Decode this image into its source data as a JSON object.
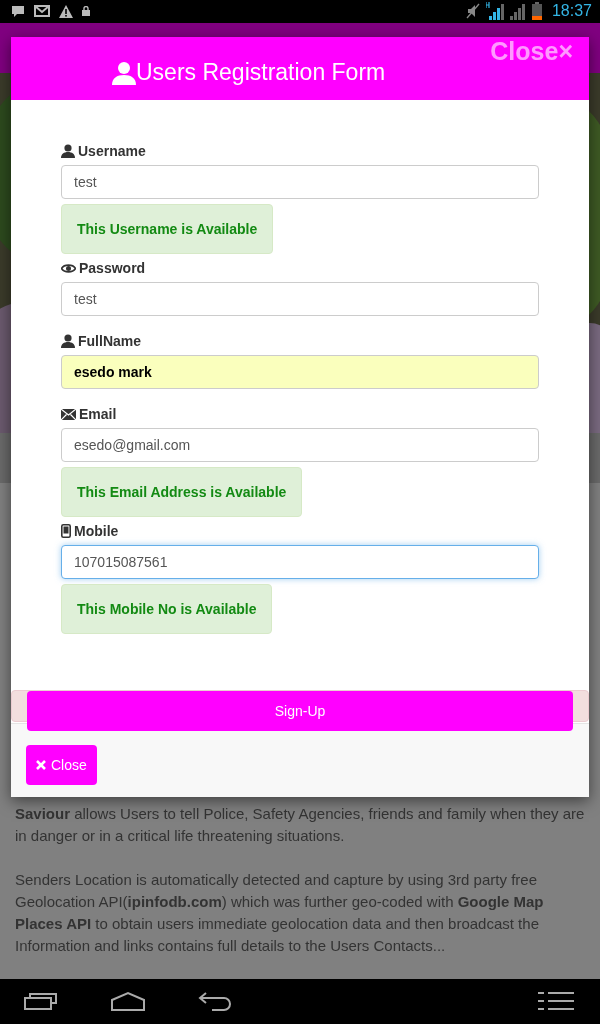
{
  "status_bar": {
    "time": "18:37"
  },
  "modal": {
    "title": "Users Registration Form",
    "header_close": "Close×",
    "fields": [
      {
        "kind": "user",
        "label": "Username",
        "value": "test",
        "autofilled": false,
        "focused": false,
        "message": "This Username is Available"
      },
      {
        "kind": "eye",
        "label": "Password",
        "value": "test",
        "autofilled": false,
        "focused": false
      },
      {
        "kind": "user",
        "label": "FullName",
        "value": "esedo mark",
        "autofilled": true,
        "focused": false
      },
      {
        "kind": "mail",
        "label": "Email",
        "value": "esedo@gmail.com",
        "autofilled": false,
        "focused": false,
        "message": "This Email Address is Available"
      },
      {
        "kind": "phone",
        "label": "Mobile",
        "value": "107015087561",
        "autofilled": false,
        "focused": true,
        "message": "This Mobile No is Available"
      }
    ],
    "submit": "Sign-Up",
    "close": "Close"
  },
  "page": {
    "paragraphs": [
      "**Saviour** allows Users to tell Police, Safety Agencies, friends and family when they are in danger or in a critical life threatening situations.",
      "Senders Location is automatically detected and capture by using 3rd party free Geolocation API(**ipinfodb.com**) which was further geo-coded with **Google Map Places API** to obtain users immediate geolocation data and then broadcast the Information and links contains full details to the Users Contacts..."
    ]
  }
}
